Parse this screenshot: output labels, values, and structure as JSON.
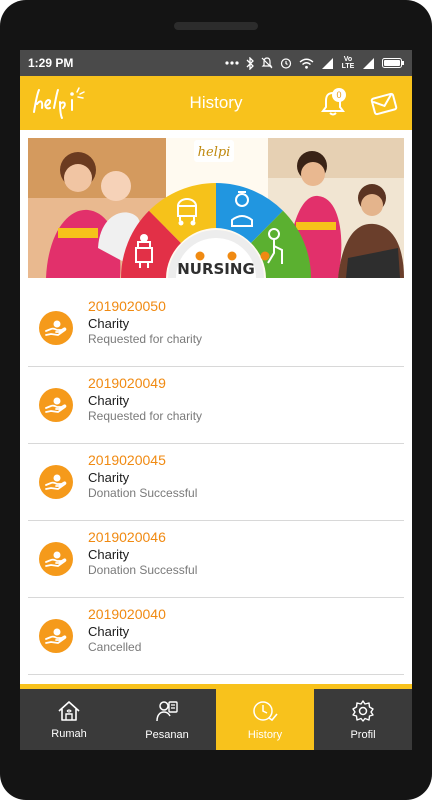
{
  "status_bar": {
    "time": "1:29 PM",
    "network": "Vo LTE"
  },
  "app_bar": {
    "title": "History",
    "notification_count": "0"
  },
  "banner": {
    "logo_text": "helpi",
    "wheel_label": "NURSING"
  },
  "history": {
    "items": [
      {
        "id": "2019020050",
        "type": "Charity",
        "status": "Requested for charity"
      },
      {
        "id": "2019020049",
        "type": "Charity",
        "status": "Requested for charity"
      },
      {
        "id": "2019020045",
        "type": "Charity",
        "status": "Donation Successful"
      },
      {
        "id": "2019020046",
        "type": "Charity",
        "status": "Donation Successful"
      },
      {
        "id": "2019020040",
        "type": "Charity",
        "status": "Cancelled"
      }
    ]
  },
  "bottom_nav": {
    "items": [
      {
        "label": "Rumah",
        "icon": "home-icon"
      },
      {
        "label": "Pesanan",
        "icon": "orders-icon"
      },
      {
        "label": "History",
        "icon": "history-icon"
      },
      {
        "label": "Profil",
        "icon": "gear-icon"
      }
    ]
  },
  "colors": {
    "primary": "#f8c21c",
    "accent": "#f59a1b",
    "nav_bg": "#3a3a3a",
    "status_bar": "#4a4a4a"
  }
}
